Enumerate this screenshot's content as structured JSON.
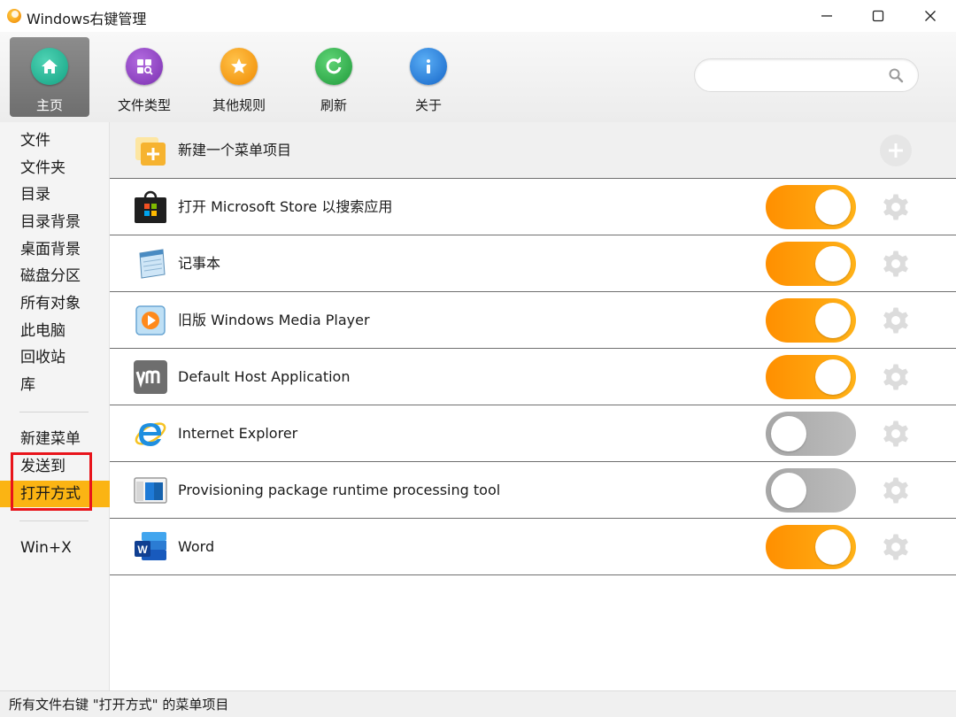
{
  "window": {
    "title": "Windows右键管理",
    "controls": {
      "minimize": "minimize-icon",
      "maximize": "maximize-icon",
      "close": "close-icon"
    }
  },
  "toolbar": {
    "items": [
      {
        "label": "主页",
        "icon": "home-icon",
        "color": "#1fb191",
        "active": true
      },
      {
        "label": "文件类型",
        "icon": "file-types-icon",
        "color": "#8a3fbf",
        "active": false
      },
      {
        "label": "其他规则",
        "icon": "star-icon",
        "color": "#f59a16",
        "active": false
      },
      {
        "label": "刷新",
        "icon": "refresh-icon",
        "color": "#27b14a",
        "active": false
      },
      {
        "label": "关于",
        "icon": "info-icon",
        "color": "#1e7fdc",
        "active": false
      }
    ],
    "search": {
      "placeholder": "",
      "icon": "search-icon"
    }
  },
  "sidebar": {
    "groups": [
      [
        "文件",
        "文件夹",
        "目录",
        "目录背景",
        "桌面背景",
        "磁盘分区",
        "所有对象",
        "此电脑",
        "回收站",
        "库"
      ],
      [
        "新建菜单",
        "发送到",
        "打开方式"
      ],
      [
        "Win+X"
      ]
    ],
    "active": "打开方式",
    "active_color": "#fbb413",
    "highlight_color": "#e8141b"
  },
  "main": {
    "new_item": {
      "label": "新建一个菜单项目",
      "icon": "new-menu-item-icon",
      "action_icon": "add-icon"
    },
    "items": [
      {
        "label": "打开 Microsoft Store 以搜索应用",
        "icon": "microsoft-store-icon",
        "enabled": true
      },
      {
        "label": "记事本",
        "icon": "notepad-icon",
        "enabled": true
      },
      {
        "label": "旧版 Windows Media Player",
        "icon": "windows-media-player-icon",
        "enabled": true
      },
      {
        "label": "Default Host Application",
        "icon": "vmware-icon",
        "enabled": true
      },
      {
        "label": "Internet Explorer",
        "icon": "internet-explorer-icon",
        "enabled": false
      },
      {
        "label": "Provisioning package runtime processing tool",
        "icon": "provisioning-tool-icon",
        "enabled": false
      },
      {
        "label": "Word",
        "icon": "word-icon",
        "enabled": true
      }
    ],
    "toggle_on_color": "#ff9a08",
    "toggle_off_color": "#b0b0b0",
    "settings_icon": "gear-icon"
  },
  "statusbar": {
    "text": "所有文件右键 \"打开方式\" 的菜单项目"
  }
}
